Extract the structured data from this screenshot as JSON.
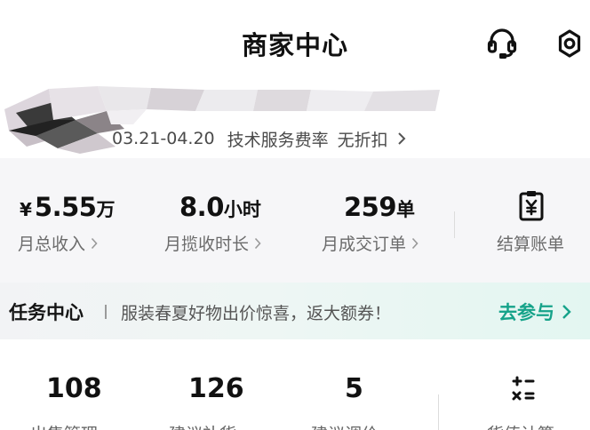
{
  "header": {
    "title": "商家中心",
    "icons": [
      "customer-service-icon",
      "settings-icon"
    ]
  },
  "shop": {
    "period": "03.21-04.20",
    "fee_label": "技术服务费率",
    "fee_value": "无折扣"
  },
  "stats": [
    {
      "currency": "¥",
      "value": "5.55",
      "unit": "万",
      "label": "月总收入"
    },
    {
      "currency": "",
      "value": "8.0",
      "unit": "小时",
      "label": "月揽收时长"
    },
    {
      "currency": "",
      "value": "259",
      "unit": "单",
      "label": "月成交订单"
    }
  ],
  "settlement": {
    "label": "结算账单",
    "icon": "bill-yen-icon"
  },
  "task": {
    "title": "任务中心",
    "desc": "服装春夏好物出价惊喜，返大额券！",
    "action": "去参与"
  },
  "quick": [
    {
      "value": "108",
      "label": "出售管理"
    },
    {
      "value": "126",
      "label": "建议补货"
    },
    {
      "value": "5",
      "label": "建议调价"
    }
  ],
  "calculator": {
    "label": "货值计算",
    "icon": "calculator-icon"
  },
  "colors": {
    "accent": "#16a38a",
    "panel": "#f6f6f8"
  }
}
